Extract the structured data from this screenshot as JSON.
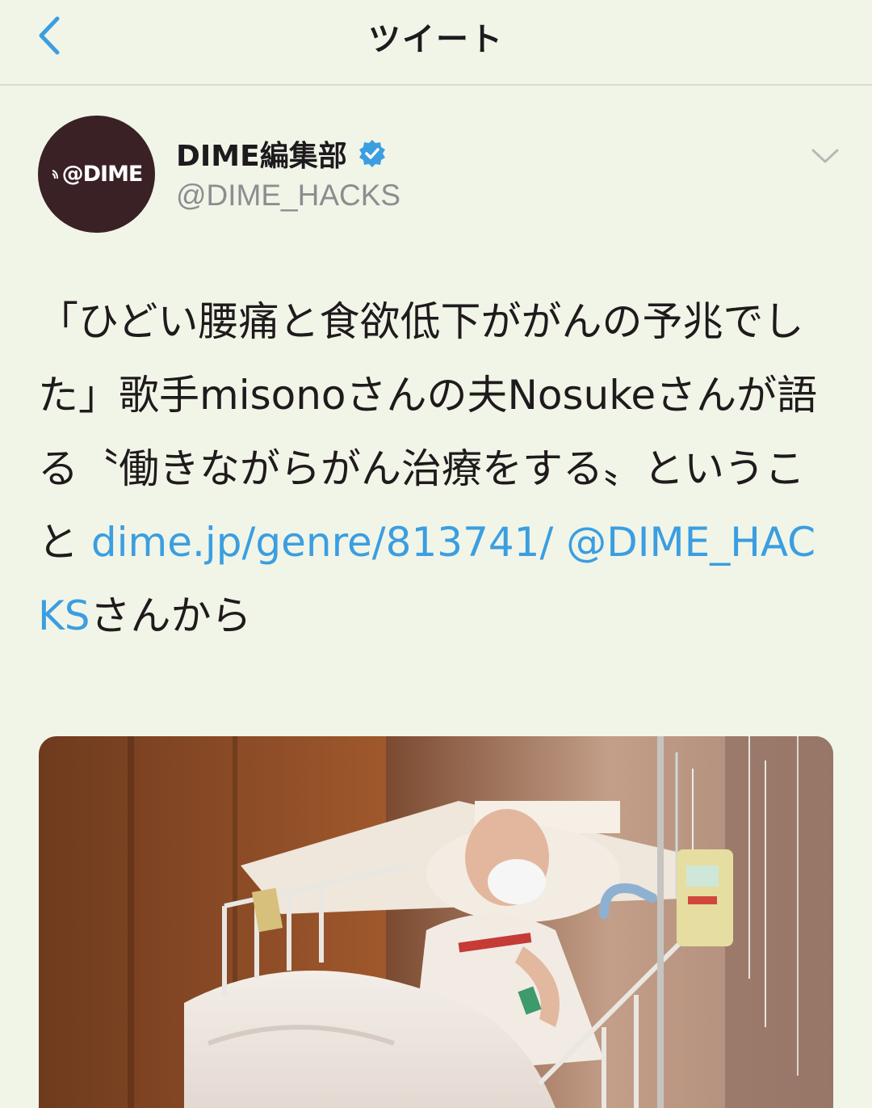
{
  "nav": {
    "title": "ツイート",
    "back_icon": "chevron-left-icon"
  },
  "tweet": {
    "avatar_text": "@DIME",
    "author_name": "DIME編集部",
    "verified_icon": "verified-badge-icon",
    "author_handle": "@DIME_HACKS",
    "more_icon": "chevron-down-icon",
    "text_before_link": "「ひどい腰痛と食欲低下ががんの予兆でした」歌手misonoさんの夫Nosukeさんが語る〝働きながらがん治療をする〟ということ ",
    "link_url": "dime.jp/genre/813741/",
    "mention": "@DIME_HACKS",
    "text_after_mention": "さんから"
  },
  "colors": {
    "background": "#f1f5e8",
    "link": "#3b9ee0",
    "handle": "#8a8e8f",
    "avatar_bg": "#3a2125",
    "verified": "#3b9ee0"
  }
}
